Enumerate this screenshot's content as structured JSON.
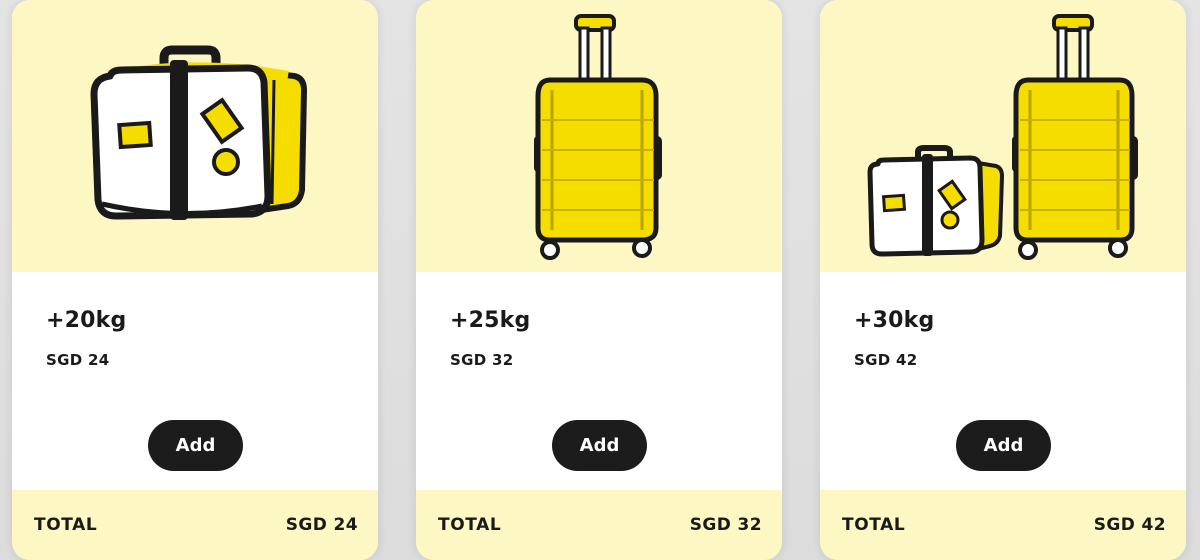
{
  "cards": [
    {
      "weight": "+20kg",
      "price": "SGD 24",
      "button_label": "Add",
      "total_label": "TOTAL",
      "total_value": "SGD 24",
      "illustration": "small-suitcase-icon"
    },
    {
      "weight": "+25kg",
      "price": "SGD 32",
      "button_label": "Add",
      "total_label": "TOTAL",
      "total_value": "SGD 32",
      "illustration": "trolley-suitcase-icon"
    },
    {
      "weight": "+30kg",
      "price": "SGD 42",
      "button_label": "Add",
      "total_label": "TOTAL",
      "total_value": "SGD 42",
      "illustration": "suitcase-pair-icon"
    }
  ],
  "colors": {
    "accent_yellow": "#f5dd00",
    "panel_cream": "#fdf7c4",
    "button_dark": "#1c1c1c",
    "text_dark": "#1a1a1a"
  }
}
